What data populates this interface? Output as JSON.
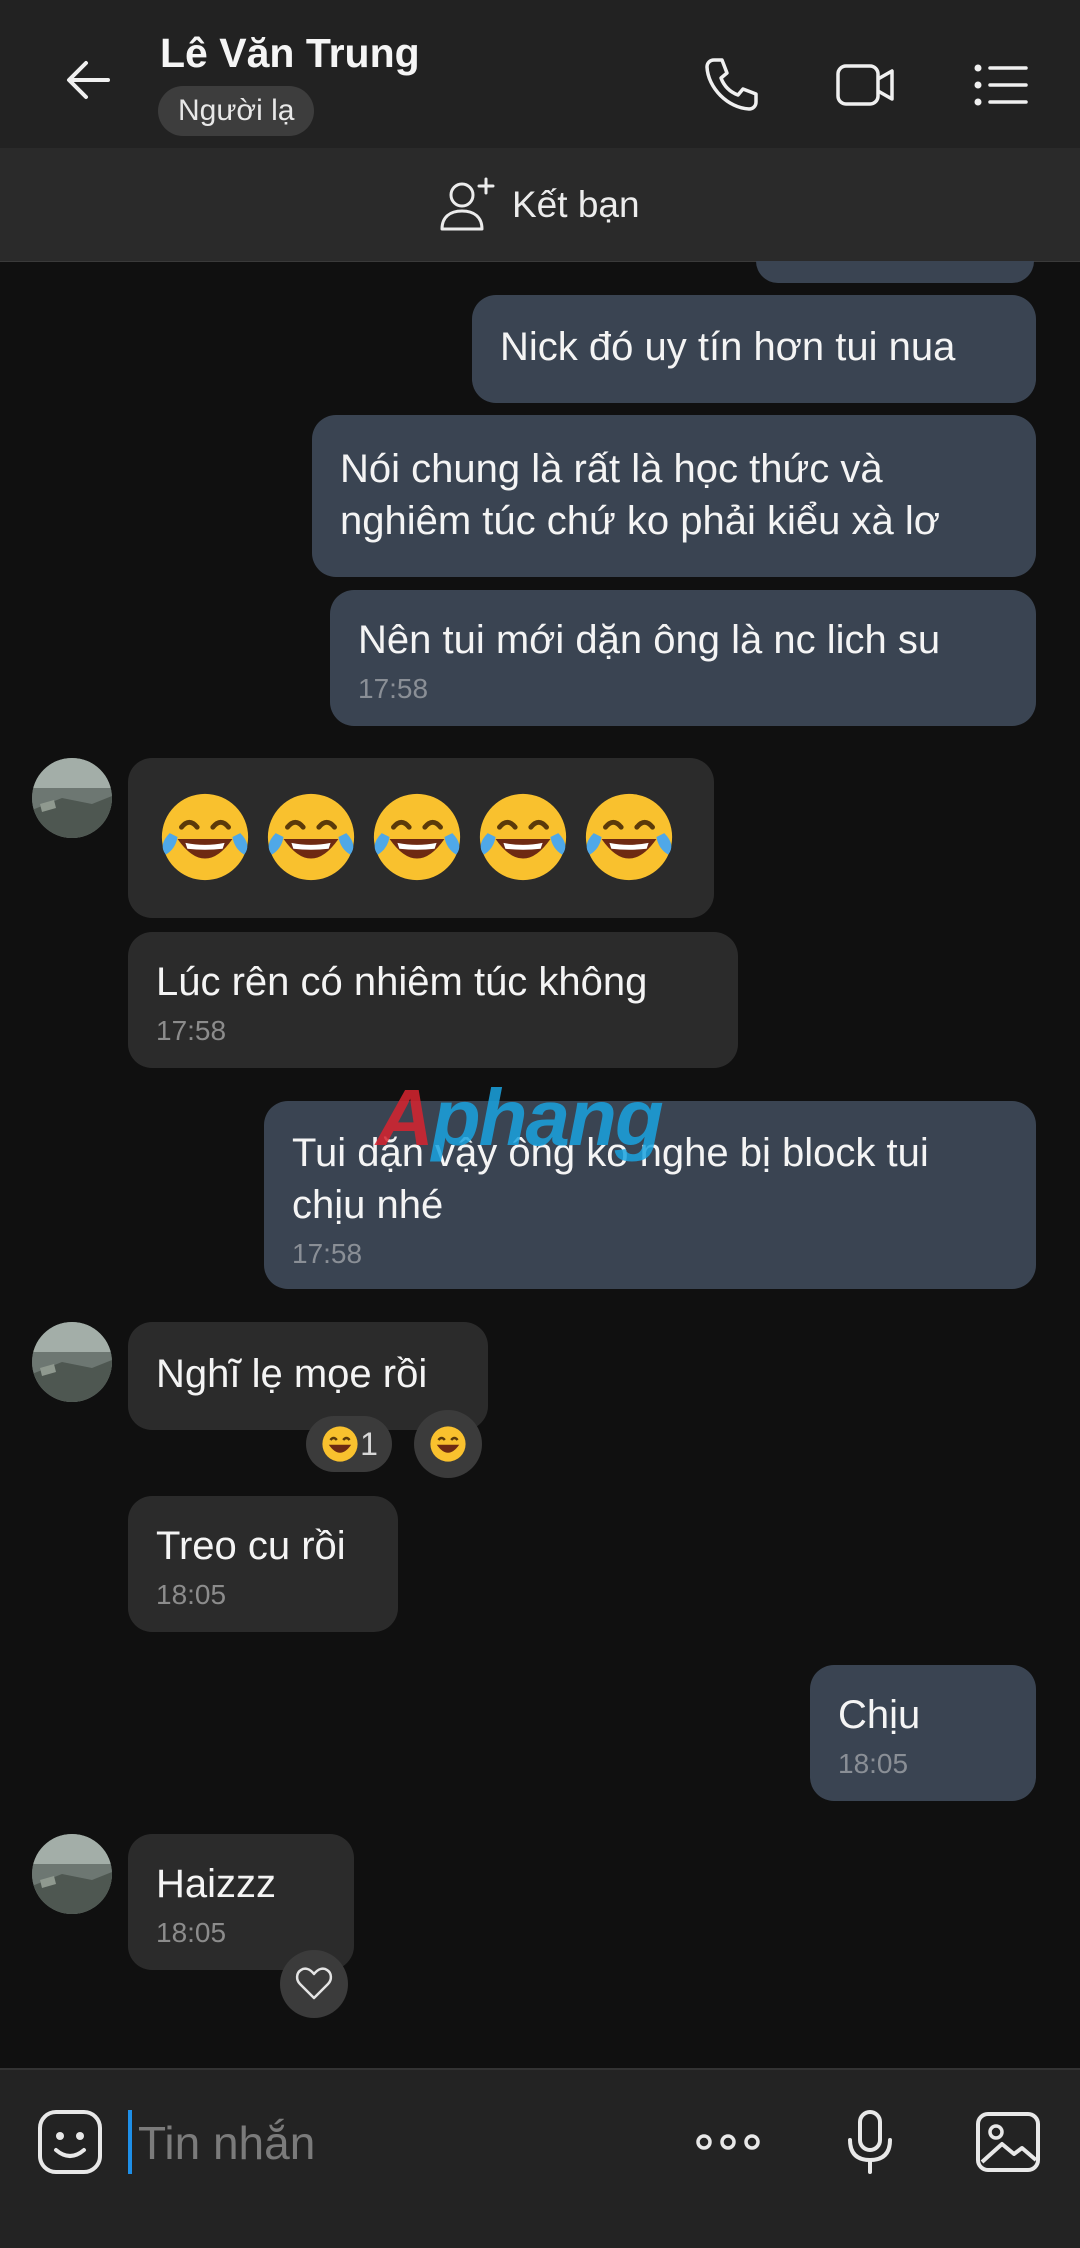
{
  "header": {
    "contact_name": "Lê Văn Trung",
    "relationship_badge": "Người lạ",
    "icons": [
      "back-arrow-icon",
      "phone-icon",
      "video-call-icon",
      "menu-list-icon"
    ]
  },
  "add_friend": {
    "label": "Kết bạn",
    "icon": "add-user-icon"
  },
  "messages": [
    {
      "from": "me",
      "text": "Nick đó uy tín hơn tui nua"
    },
    {
      "from": "me",
      "text": "Nói chung là rất là học thức và",
      "text2": "nghiêm túc chứ ko phải kiểu xà lơ"
    },
    {
      "from": "me",
      "text": "Nên tui mới dặn ông là nc lich su",
      "time": "17:58"
    },
    {
      "from": "contact",
      "emoji": "😂😂😂😂😂"
    },
    {
      "from": "contact",
      "text": "Lúc rên có nhiêm túc không",
      "time": "17:58"
    },
    {
      "from": "me",
      "text": "Tui dặn vậy ông ko nghe bị block tui",
      "text2": "chịu nhé",
      "time": "17:58"
    },
    {
      "from": "contact",
      "text": "Nghĩ lẹ mọe rồi",
      "reaction_count": "1"
    },
    {
      "from": "contact",
      "text": "Treo cu rồi",
      "time": "18:05"
    },
    {
      "from": "me",
      "text": "Chịu",
      "time": "18:05"
    },
    {
      "from": "contact",
      "text": "Haizzz",
      "time": "18:05"
    }
  ],
  "watermark": {
    "first": "A",
    "rest": "phang"
  },
  "input": {
    "placeholder": "Tin nhắn",
    "icons": [
      "sticker-icon",
      "more-options-icon",
      "microphone-icon",
      "image-icon"
    ]
  },
  "colors": {
    "background": "#101010",
    "header": "#222222",
    "sent_bubble": "#3a4452",
    "received_bubble": "#2b2b2b",
    "caret": "#1e8fe8"
  }
}
